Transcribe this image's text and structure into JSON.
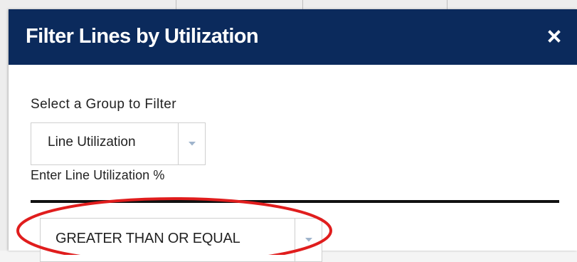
{
  "panel": {
    "title": "Filter Lines by Utilization",
    "close_icon": "close-icon"
  },
  "filter": {
    "group_label": "Select a Group to Filter",
    "group_select": {
      "value": "Line Utilization",
      "arrow_icon": "caret-down-icon"
    },
    "value_label": "Enter Line Utilization %",
    "operator_select": {
      "value": "GREATER THAN OR EQUAL",
      "arrow_icon": "caret-down-icon"
    }
  },
  "colors": {
    "header_bg": "#0b2a5c",
    "header_text": "#ffffff",
    "highlight": "#e01d1d",
    "arrow": "#9fb4cc"
  }
}
